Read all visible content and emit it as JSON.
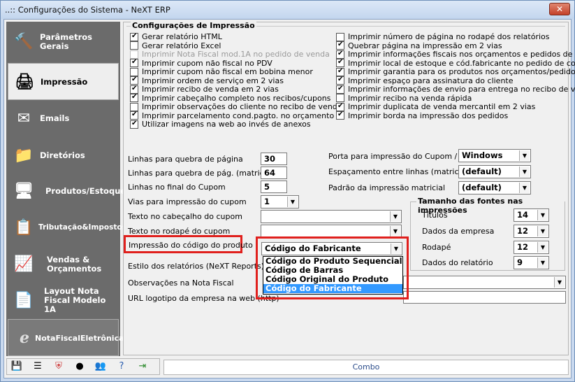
{
  "window": {
    "title": "..:: Configurações do Sistema - NeXT ERP",
    "close": "✕"
  },
  "sidebar": [
    {
      "label": "Parâmetros Gerais",
      "icon": "🔨"
    },
    {
      "label": "Impressão",
      "icon": "🖨"
    },
    {
      "label": "Emails",
      "icon": "✉"
    },
    {
      "label": "Diretórios",
      "icon": "📁"
    },
    {
      "label": "Produtos/Estoque",
      "icon": "🖥"
    },
    {
      "label": "Tributação&Impostos",
      "icon": "📋"
    },
    {
      "label": "Vendas & Orçamentos",
      "icon": "📈"
    },
    {
      "label": "Layout Nota Fiscal Modelo 1A",
      "icon": "📄"
    },
    {
      "label": "NotaFiscalEletrônica",
      "icon": "e"
    }
  ],
  "group_title": "Configurações de Impressão",
  "checks_left": [
    {
      "label": "Gerar relatório HTML",
      "checked": true
    },
    {
      "label": "Gerar relatório Excel",
      "checked": false
    },
    {
      "label": "Imprimir Nota Fiscal mod.1A no pedido de venda",
      "checked": false,
      "disabled": true
    },
    {
      "label": "Imprimir cupom não fiscal no PDV",
      "checked": true
    },
    {
      "label": "Imprimir cupom não fiscal em bobina menor",
      "checked": false
    },
    {
      "label": "Imprimir ordem de serviço em 2 vias",
      "checked": true
    },
    {
      "label": "Imprimir recibo de venda em 2 vias",
      "checked": true
    },
    {
      "label": "Imprimir cabeçalho completo nos recibos/cupons",
      "checked": true
    },
    {
      "label": "Imprimir observações do cliente no recibo de venda",
      "checked": false
    },
    {
      "label": "Imprimir parcelamento cond.pagto. no orçamento",
      "checked": true
    },
    {
      "label": "Utilizar imagens na web ao invés de anexos",
      "checked": true
    }
  ],
  "checks_right": [
    {
      "label": "Imprimir número de página no rodapé dos relatórios",
      "checked": false
    },
    {
      "label": "Quebrar página na impressão em 2 vias",
      "checked": true
    },
    {
      "label": "Imprimir informações fiscais nos orçamentos e pedidos de vendas",
      "checked": true
    },
    {
      "label": "Imprimir local de estoque e cód.fabricante no pedido de compra",
      "checked": true
    },
    {
      "label": "Imprimir garantia para os produtos nos orçamentos/pedidos",
      "checked": true
    },
    {
      "label": "Imprimir espaço para assinatura do cliente",
      "checked": true
    },
    {
      "label": "Imprimir informações de envio para entrega no recibo de venda",
      "checked": true
    },
    {
      "label": "Imprimir recibo na venda rápida",
      "checked": false
    },
    {
      "label": "Imprimir duplicata de venda mercantil em 2 vias",
      "checked": true
    },
    {
      "label": "Imprimir borda na impressão dos pedidos",
      "checked": true
    }
  ],
  "fields": {
    "linhas_quebra": {
      "label": "Linhas para quebra de página",
      "value": "30"
    },
    "linhas_quebra_matricial": {
      "label": "Linhas para quebra de pág. (matricial)",
      "value": "64"
    },
    "linhas_final_cupom": {
      "label": "Linhas no final do Cupom",
      "value": "5"
    },
    "vias_cupom": {
      "label": "Vias para impressão do cupom",
      "value": "1"
    },
    "texto_cabecalho": {
      "label": "Texto no cabeçalho do cupom",
      "value": ""
    },
    "texto_rodape": {
      "label": "Texto no rodapé do cupom",
      "value": ""
    },
    "impressao_codigo": {
      "label": "Impressão do código do produto",
      "value": "Código do Fabricante"
    },
    "estilo_relatorios": {
      "label": "Estilo dos relatórios (NeXT Reports)"
    },
    "observacoes_nf": {
      "label": "Observações na Nota Fiscal"
    },
    "url_logotipo": {
      "label": "URL logotipo da empresa na web (http)"
    },
    "porta_cupom": {
      "label": "Porta para impressão do Cupom / NF",
      "value": "Windows"
    },
    "espacamento": {
      "label": "Espaçamento entre linhas (matricial)",
      "value": "(default)"
    },
    "padrao_matricial": {
      "label": "Padrão da impressão matricial",
      "value": "(default)"
    }
  },
  "dropdown_options": [
    "Código do Produto Sequencial",
    "Código de Barras",
    "Código Original do Produto",
    "Código do Fabricante"
  ],
  "fontes": {
    "title": "Tamanho das fontes nas impressões",
    "titulos": {
      "label": "Títulos",
      "value": "14"
    },
    "dados_empresa": {
      "label": "Dados da empresa",
      "value": "12"
    },
    "rodape": {
      "label": "Rodapé",
      "value": "12"
    },
    "dados_relatorio": {
      "label": "Dados do relatório",
      "value": "9"
    }
  },
  "status": "Combo",
  "accent": {
    "highlight": "#3399ff",
    "red_box": "#e0201d"
  }
}
